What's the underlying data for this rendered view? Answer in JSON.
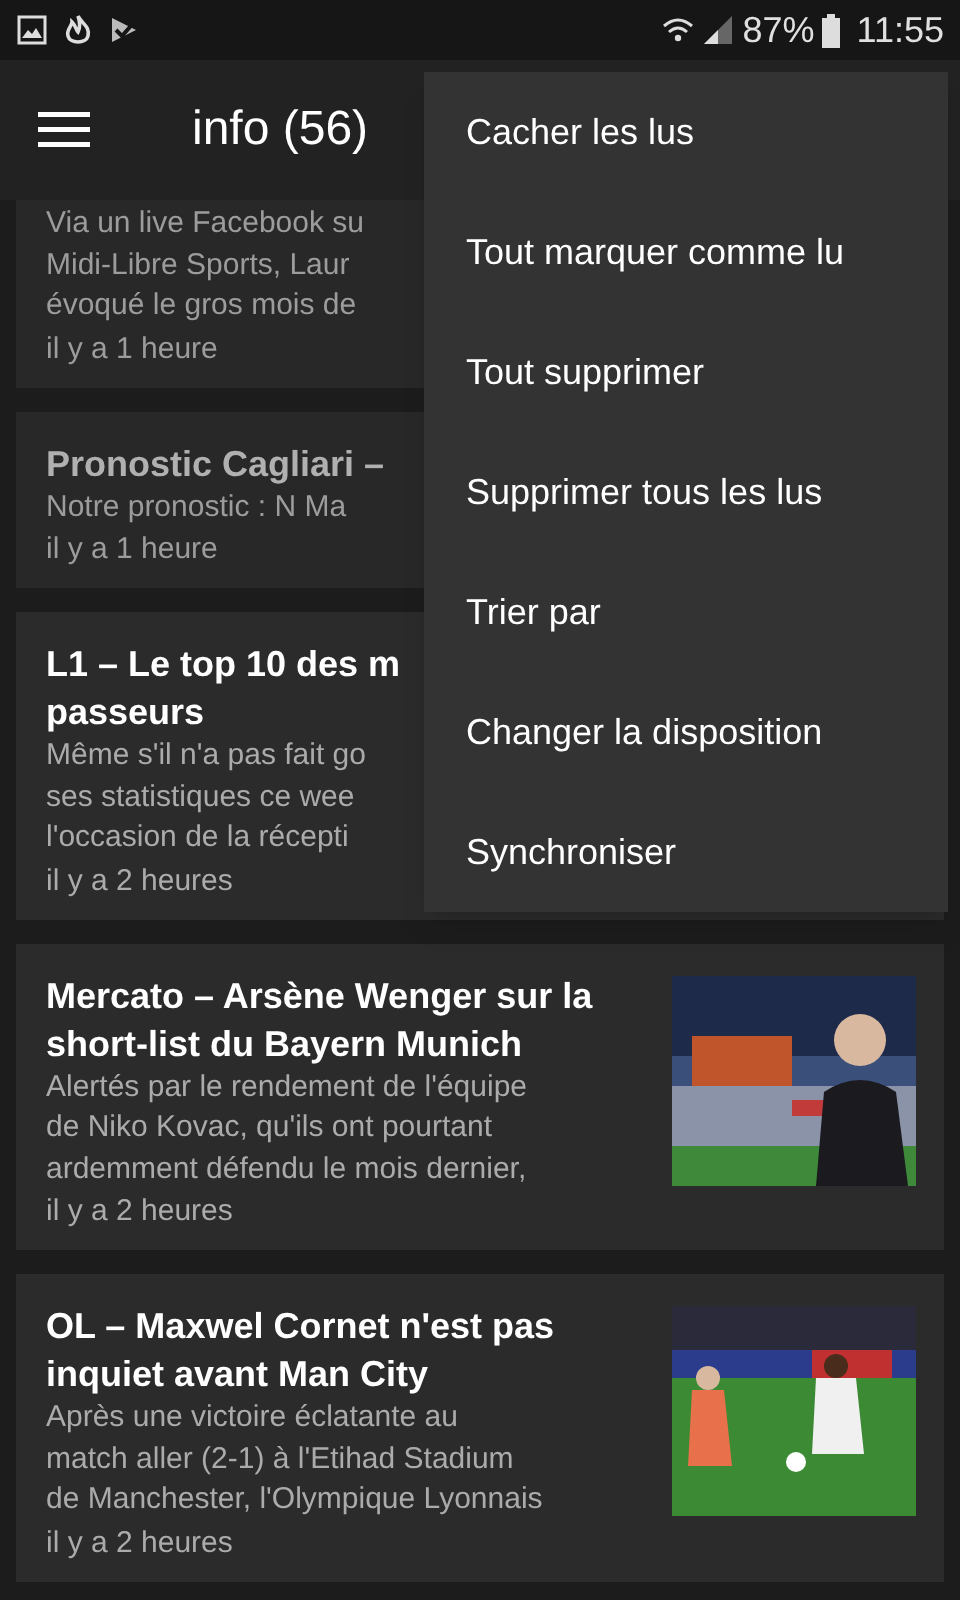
{
  "status_bar": {
    "battery": "87%",
    "time": "11:55"
  },
  "toolbar": {
    "title": "info (56)"
  },
  "articles": [
    {
      "read": true,
      "description": [
        "Via un live Facebook su",
        "Midi-Libre Sports, Laur",
        "évoqué le gros mois de"
      ],
      "time": "il y a 1 heure"
    },
    {
      "read": true,
      "title": [
        "Pronostic Cagliari –"
      ],
      "description": [
        "Notre pronostic : N Ma"
      ],
      "time": "il y a 1 heure"
    },
    {
      "read": false,
      "title": [
        "L1 – Le top 10 des m",
        "passeurs"
      ],
      "description": [
        "Même s'il n'a pas fait go",
        "ses statistiques ce wee",
        "l'occasion de la récepti"
      ],
      "time": "il y a 2 heures"
    },
    {
      "read": false,
      "title": [
        "Mercato – Arsène Wenger sur la",
        "short-list du Bayern Munich"
      ],
      "description": [
        "Alertés par le rendement de l'équipe",
        "de Niko Kovac, qu'ils ont pourtant",
        "ardemment défendu le mois dernier,"
      ],
      "time": "il y a 2 heures",
      "image": {
        "kind": "picture"
      }
    },
    {
      "read": false,
      "title": [
        "OL – Maxwel Cornet n'est pas",
        "inquiet avant Man City"
      ],
      "description": [
        "Après une victoire éclatante au",
        "match aller (2-1) à l'Etihad Stadium",
        "de Manchester, l'Olympique Lyonnais"
      ],
      "time": "il y a 2 heures",
      "image": {
        "kind": "picture"
      }
    }
  ],
  "menu": [
    "Cacher les lus",
    "Tout marquer comme lu",
    "Tout supprimer",
    "Supprimer tous les lus",
    "Trier par",
    "Changer la disposition",
    "Synchroniser"
  ]
}
